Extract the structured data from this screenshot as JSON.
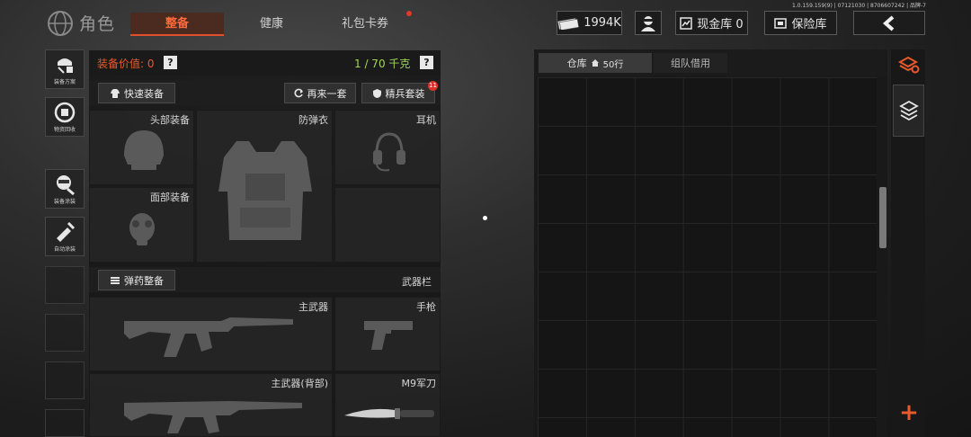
{
  "version": "1.0.159.159(9) | 07121030 | 8706607242 | 品牌-7",
  "header": {
    "title": "角色",
    "tabs": [
      {
        "label": "整备",
        "active": true
      },
      {
        "label": "健康",
        "active": false
      },
      {
        "label": "礼包卡券",
        "active": false
      }
    ],
    "money": "1994K",
    "cash_store": "现金库 0",
    "safe": "保险库",
    "back_icon": "chevron-left-icon"
  },
  "sidebar": {
    "items": [
      {
        "label": "装备方案",
        "icon": "gear-plan-icon"
      },
      {
        "label": "物资回收",
        "icon": "recycle-icon"
      },
      {
        "label": "装备涂装",
        "icon": "paint-icon"
      },
      {
        "label": "自动涂装",
        "icon": "auto-paint-icon"
      }
    ]
  },
  "equipment": {
    "value_label": "装备价值: 0",
    "help": "?",
    "weight": "1 / 70 千克",
    "quick_equip": "快速装备",
    "again": "再来一套",
    "elite": "精兵套装",
    "elite_badge": "11",
    "slots": {
      "head": "头部装备",
      "armor": "防弹衣",
      "headset": "耳机",
      "face": "面部装备"
    },
    "ammo": "弹药整备",
    "weapon_bar": "武器栏",
    "weapons": {
      "primary": "主武器",
      "pistol": "手枪",
      "primary_back": "主武器(背部)",
      "knife": "M9军刀"
    }
  },
  "warehouse": {
    "tab_main": "仓库",
    "rows": "50行",
    "tab_team": "组队借用",
    "add": "+"
  },
  "colors": {
    "accent": "#e9592b",
    "weight": "#9fd45a",
    "badge": "#d8332a"
  }
}
